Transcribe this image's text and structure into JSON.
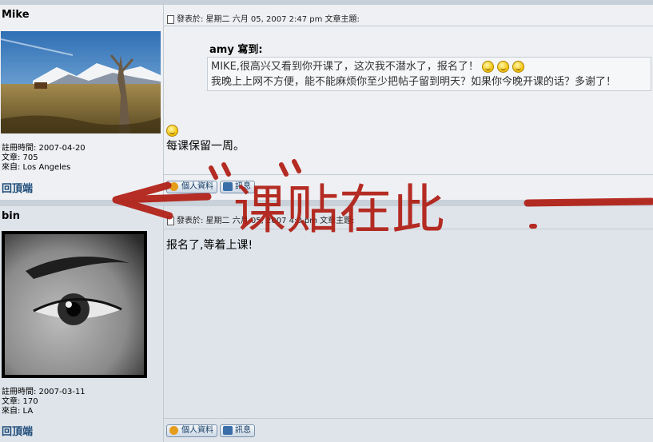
{
  "posts": [
    {
      "username": "Mike",
      "info": {
        "registered": "註冊時間: 2007-04-20",
        "posts": "文章: 705",
        "location": "來自: Los Angeles"
      },
      "meta": "發表於: 星期二 六月 05, 2007 2:47 pm    文章主題:",
      "quote_title": "amy 寫到:",
      "quote_line1": "MIKE,很高兴又看到你开课了，这次我不潜水了，报名了！",
      "quote_line2": "我晚上上网不方便，能不能麻烦你至少把帖子留到明天？如果你今晚开课的话？多谢了！",
      "body": "每课保留一周。",
      "back_to_top": "回頂端",
      "profile_button": "個人資料",
      "pm_button": "訊息"
    },
    {
      "username": "bin",
      "info": {
        "registered": "註冊時間: 2007-03-11",
        "posts": "文章: 170",
        "location": "來自: LA"
      },
      "meta": "發表於: 星期二 六月 05, 2007 4:0  pm  文章主題:",
      "body": "报名了,等着上课!",
      "back_to_top": "回頂端",
      "profile_button": "個人資料",
      "pm_button": "訊息"
    }
  ],
  "annotation": {
    "text": "课贴在此",
    "color": "#b01c12"
  }
}
